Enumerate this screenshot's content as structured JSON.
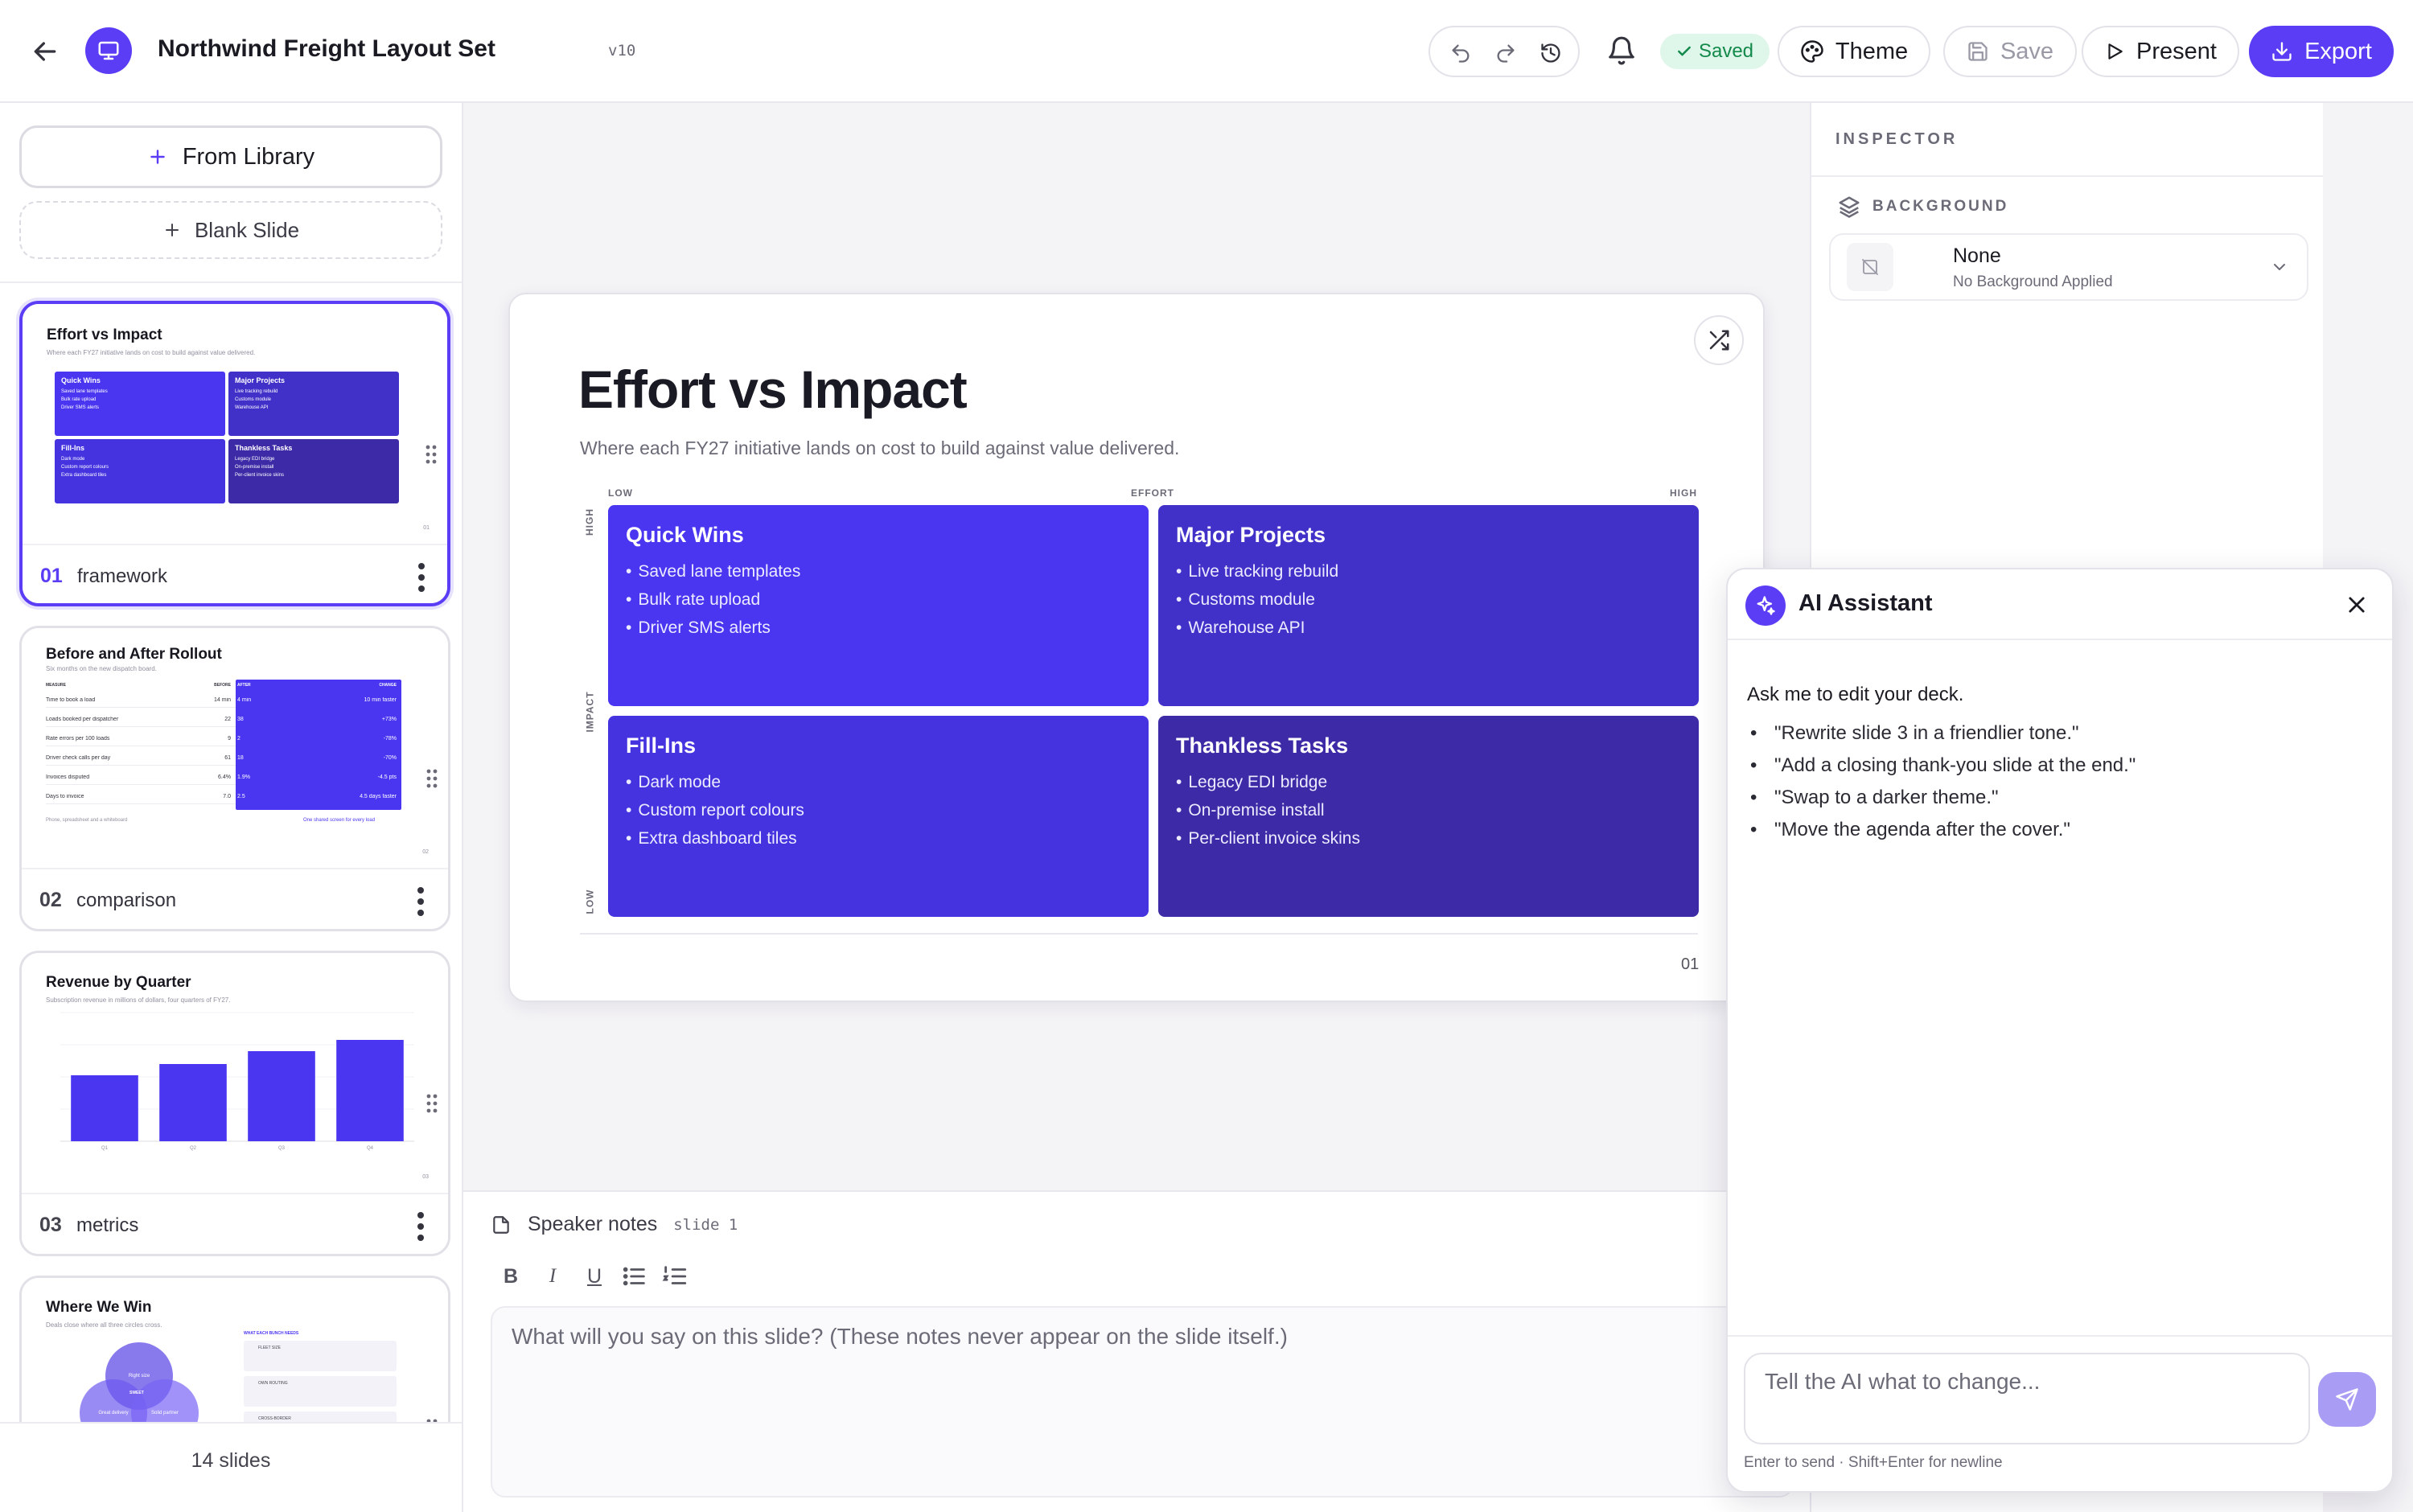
{
  "header": {
    "doc_title": "Northwind Freight Layout Set",
    "version": "v10",
    "saved_label": "Saved",
    "theme_label": "Theme",
    "save_label": "Save",
    "present_label": "Present",
    "export_label": "Export"
  },
  "sidebar": {
    "from_library_label": "From Library",
    "blank_slide_label": "Blank Slide",
    "slide_count": "14 slides",
    "thumbnails": [
      {
        "num": "01",
        "name": "framework",
        "title": "Effort vs Impact",
        "subtitle": "Where each FY27 initiative lands on cost to build against value delivered.",
        "quads": [
          {
            "title": "Quick Wins",
            "items": [
              "Saved lane templates",
              "Bulk rate upload",
              "Driver SMS alerts"
            ]
          },
          {
            "title": "Major Projects",
            "items": [
              "Live tracking rebuild",
              "Customs module",
              "Warehouse API"
            ]
          },
          {
            "title": "Fill-Ins",
            "items": [
              "Dark mode",
              "Custom report colours",
              "Extra dashboard tiles"
            ]
          },
          {
            "title": "Thankless Tasks",
            "items": [
              "Legacy EDI bridge",
              "On-premise install",
              "Per-client invoice skins"
            ]
          }
        ]
      },
      {
        "num": "02",
        "name": "comparison",
        "title": "Before and After Rollout",
        "subtitle": "Six months on the new dispatch board.",
        "headers": [
          "MEASURE",
          "BEFORE",
          "AFTER",
          "CHANGE"
        ],
        "rows": [
          [
            "Time to book a load",
            "14 min",
            "4 min",
            "10 min faster"
          ],
          [
            "Loads booked per dispatcher",
            "22",
            "38",
            "+73%"
          ],
          [
            "Rate errors per 100 loads",
            "9",
            "2",
            "-78%"
          ],
          [
            "Driver check calls per day",
            "61",
            "18",
            "-70%"
          ],
          [
            "Invoices disputed",
            "6.4%",
            "1.9%",
            "-4.5 pts"
          ],
          [
            "Days to invoice",
            "7.0",
            "2.5",
            "4.5 days faster"
          ]
        ],
        "left_note": "Phone, spreadsheet and a whiteboard",
        "right_note": "One shared screen for every load"
      },
      {
        "num": "03",
        "name": "metrics",
        "title": "Revenue by Quarter",
        "subtitle": "Subscription revenue in millions of dollars, four quarters of FY27.",
        "chart_data": {
          "type": "bar",
          "categories": [
            "Q1",
            "Q2",
            "Q3",
            "Q4"
          ],
          "values": [
            4.1,
            4.8,
            5.6,
            6.3
          ],
          "ylim": [
            0,
            8
          ]
        }
      },
      {
        "num": "04",
        "name": "",
        "title": "Where We Win",
        "subtitle": "Deals close where all three circles cross.",
        "circles": [
          "Right size",
          "Great delivery",
          "Solid partner",
          "SWEET"
        ],
        "panel_title": "WHAT EACH BUNCH NEEDS",
        "panel_items": [
          "FLEET SIZE",
          "OWN ROUTING",
          "CROSS-BORDER"
        ]
      }
    ]
  },
  "slide": {
    "title": "Effort vs Impact",
    "subtitle": "Where each FY27 initiative lands on cost to build against value delivered.",
    "x_axis": {
      "low": "LOW",
      "label": "EFFORT",
      "high": "HIGH"
    },
    "y_axis": {
      "high": "HIGH",
      "label": "IMPACT",
      "low": "LOW"
    },
    "page_number": "01",
    "quadrants": [
      {
        "title": "Quick Wins",
        "items": [
          "Saved lane templates",
          "Bulk rate upload",
          "Driver SMS alerts"
        ],
        "color": "#4a35f0"
      },
      {
        "title": "Major Projects",
        "items": [
          "Live tracking rebuild",
          "Customs module",
          "Warehouse API"
        ],
        "color": "#4231c9"
      },
      {
        "title": "Fill-Ins",
        "items": [
          "Dark mode",
          "Custom report colours",
          "Extra dashboard tiles"
        ],
        "color": "#4533e0"
      },
      {
        "title": "Thankless Tasks",
        "items": [
          "Legacy EDI bridge",
          "On-premise install",
          "Per-client invoice skins"
        ],
        "color": "#3c2aa6"
      }
    ]
  },
  "notes": {
    "title": "Speaker notes",
    "slide_ref": "slide 1",
    "placeholder": "What will you say on this slide? (These notes never appear on the slide itself.)"
  },
  "inspector": {
    "label": "INSPECTOR",
    "background_label": "BACKGROUND",
    "background_value": "None",
    "background_desc": "No Background Applied"
  },
  "ai": {
    "title": "AI Assistant",
    "intro": "Ask me to edit your deck.",
    "suggestions": [
      "\"Rewrite slide 3 in a friendlier tone.\"",
      "\"Add a closing thank-you slide at the end.\"",
      "\"Swap to a darker theme.\"",
      "\"Move the agenda after the cover.\""
    ],
    "input_placeholder": "Tell the AI what to change...",
    "hint": "Enter to send · Shift+Enter for newline"
  },
  "colors": {
    "accent": "#5b3df5",
    "saved_bg": "#dff6ea",
    "saved_text": "#138a4b"
  }
}
